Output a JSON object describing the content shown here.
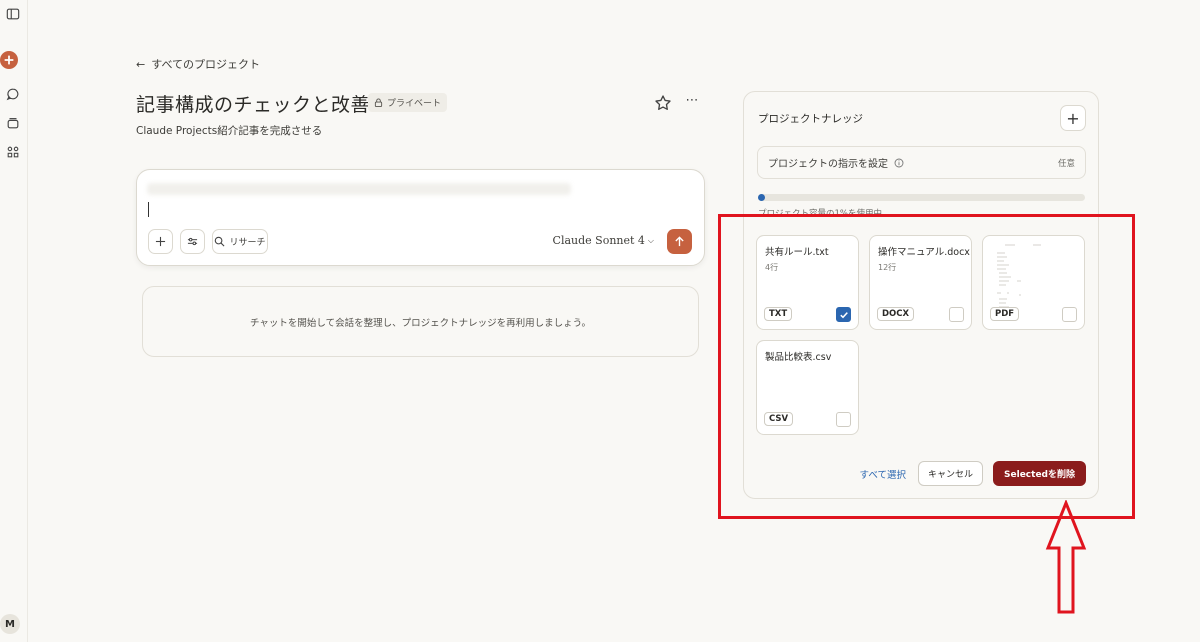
{
  "back_link": "すべてのプロジェクト",
  "project": {
    "title": "記事構成のチェックと改善",
    "privacy_badge": "プライベート",
    "description": "Claude Projects紹介記事を完成させる"
  },
  "composer": {
    "research_label": "リサーチ",
    "model": "Claude Sonnet 4"
  },
  "empty_state": "チャットを開始して会話を整理し、プロジェクトナレッジを再利用しましょう。",
  "knowledge": {
    "title": "プロジェクトナレッジ",
    "instructions_label": "プロジェクトの指示を設定",
    "instructions_optional": "任意",
    "usage_text": "プロジェクト容量の1%を使用中",
    "usage_fraction": 0.01,
    "files": [
      {
        "name": "共有ルール.txt",
        "lines": "4行",
        "type": "TXT",
        "checked": true
      },
      {
        "name": "操作マニュアル.docx",
        "lines": "12行",
        "type": "DOCX",
        "checked": false
      },
      {
        "name": "",
        "lines": "",
        "type": "PDF",
        "checked": false
      },
      {
        "name": "製品比較表.csv",
        "lines": "",
        "type": "CSV",
        "checked": false
      }
    ],
    "select_all": "すべて選択",
    "cancel": "キャンセル",
    "delete_selected": "Selectedを削除"
  },
  "user_avatar": "M",
  "colors": {
    "accent": "#c6613f",
    "selection": "#2b66b0",
    "danger": "#8b1c1c",
    "annotation": "#e0141e"
  }
}
